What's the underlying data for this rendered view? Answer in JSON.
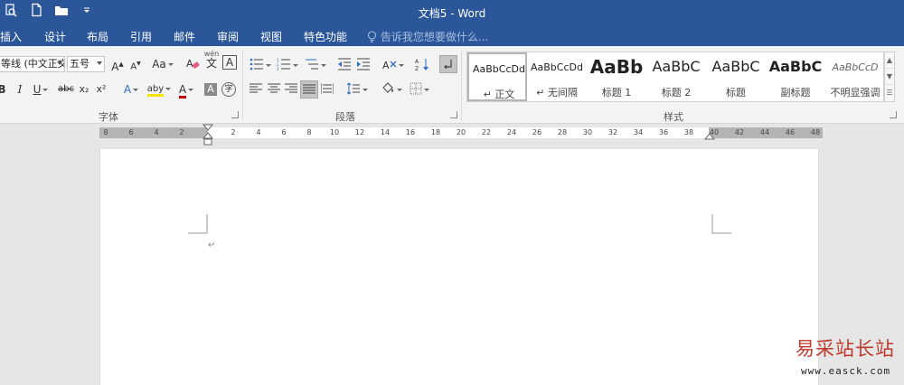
{
  "window": {
    "title": "文档5 - Word"
  },
  "tabs": [
    {
      "label": "插入"
    },
    {
      "label": "设计"
    },
    {
      "label": "布局"
    },
    {
      "label": "引用"
    },
    {
      "label": "邮件"
    },
    {
      "label": "审阅"
    },
    {
      "label": "视图"
    },
    {
      "label": "特色功能"
    }
  ],
  "tell_me": {
    "placeholder": "告诉我您想要做什么..."
  },
  "font_group": {
    "label": "字体",
    "font_name": "等线 (中文正文",
    "font_size": "五号",
    "grow_label": "A",
    "shrink_label": "A",
    "case_label": "Aa",
    "phonetic_label": "wén",
    "phonetic_char": "文",
    "border_char": "A",
    "bold": "B",
    "italic": "I",
    "underline": "U",
    "strike": "abc",
    "subscript": "x₂",
    "superscript": "x²",
    "effects": "A",
    "highlight": "aby",
    "font_color": "A",
    "shading": "A",
    "enclose": "字"
  },
  "paragraph_group": {
    "label": "段落"
  },
  "styles_group": {
    "label": "样式",
    "items": [
      {
        "preview": "AaBbCcDd",
        "name": "↵ 正文"
      },
      {
        "preview": "AaBbCcDd",
        "name": "↵ 无间隔"
      },
      {
        "preview": "AaBb",
        "name": "标题 1"
      },
      {
        "preview": "AaBbC",
        "name": "标题 2"
      },
      {
        "preview": "AaBbC",
        "name": "标题"
      },
      {
        "preview": "AaBbC",
        "name": "副标题"
      },
      {
        "preview": "AaBbCcD",
        "name": "不明显强调"
      }
    ]
  },
  "ruler": {
    "left_numbers": [
      "8",
      "6",
      "4",
      "2"
    ],
    "numbers": [
      "2",
      "4",
      "6",
      "8",
      "10",
      "12",
      "14",
      "16",
      "18",
      "20",
      "22",
      "24",
      "26",
      "28",
      "30",
      "32",
      "34",
      "36",
      "38",
      "40",
      "42",
      "44",
      "46",
      "48"
    ]
  },
  "document": {
    "paragraph_mark": "↵"
  },
  "watermark": {
    "text": "易采站长站",
    "url": "www.easck.com"
  },
  "colors": {
    "brand": "#2b579a",
    "ribbon": "#f3f3f3",
    "workspace": "#e6e6e6"
  }
}
